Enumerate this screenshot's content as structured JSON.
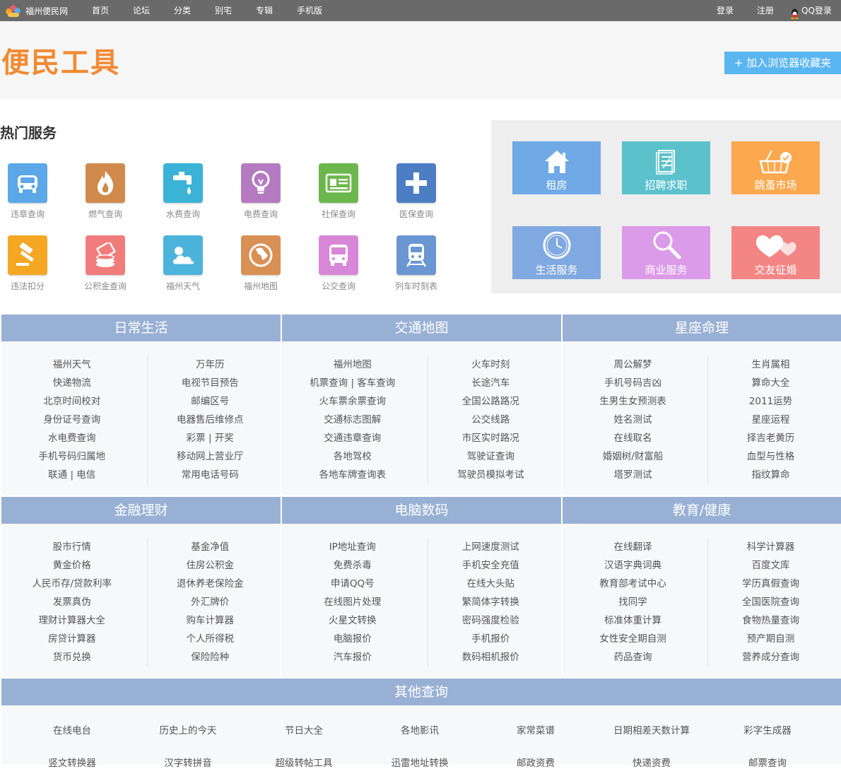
{
  "topbar": {
    "logo_text": "福州便民网",
    "nav": [
      "首页",
      "论坛",
      "分类",
      "别宅",
      "专辑",
      "手机版"
    ],
    "login": "登录",
    "register": "注册",
    "qq_login": "QQ登录"
  },
  "hero": {
    "title": "便民工具",
    "favorite_button": "+ 加入浏览器收藏夹"
  },
  "hot": {
    "title": "热门服务",
    "services": [
      {
        "label": "违章查询",
        "icon": "car-icon",
        "color": "#5ba7e8"
      },
      {
        "label": "燃气查询",
        "icon": "flame-icon",
        "color": "#d08a4c"
      },
      {
        "label": "水费查询",
        "icon": "faucet-icon",
        "color": "#3ab3d6"
      },
      {
        "label": "电费查询",
        "icon": "lightbulb-icon",
        "color": "#b57bc1"
      },
      {
        "label": "社保查询",
        "icon": "id-card-icon",
        "color": "#6cb74d"
      },
      {
        "label": "医保查询",
        "icon": "medical-cross-icon",
        "color": "#4c7ec4"
      },
      {
        "label": "违法扣分",
        "icon": "gavel-icon",
        "color": "#f5a623"
      },
      {
        "label": "公积金查询",
        "icon": "coins-icon",
        "color": "#f07c7c"
      },
      {
        "label": "福州天气",
        "icon": "weather-icon",
        "color": "#4cb3db"
      },
      {
        "label": "福州地图",
        "icon": "globe-icon",
        "color": "#d99054"
      },
      {
        "label": "公交查询",
        "icon": "bus-icon",
        "color": "#d887d8"
      },
      {
        "label": "列车时刻表",
        "icon": "train-icon",
        "color": "#6a96d1"
      }
    ],
    "tiles": [
      {
        "label": "租房",
        "icon": "house-icon",
        "color": "#6fa9e6"
      },
      {
        "label": "招聘求职",
        "icon": "document-icon",
        "color": "#5bc2cc"
      },
      {
        "label": "跳蚤市场",
        "icon": "basket-icon",
        "color": "#fba84e"
      },
      {
        "label": "生活服务",
        "icon": "clock-icon",
        "color": "#7fa9e0"
      },
      {
        "label": "商业服务",
        "icon": "magnifier-icon",
        "color": "#dc9be8"
      },
      {
        "label": "交友征婚",
        "icon": "hearts-icon",
        "color": "#f48585"
      }
    ]
  },
  "categories": [
    {
      "title": "日常生活",
      "left": [
        "福州天气",
        "快递物流",
        "北京时间校对",
        "身份证号查询",
        "水电费查询",
        "手机号码归属地",
        "联通 | 电信"
      ],
      "right": [
        "万年历",
        "电视节目预告",
        "邮编区号",
        "电器售后维修点",
        "彩票 | 开奖",
        "移动网上营业厅",
        "常用电话号码"
      ]
    },
    {
      "title": "交通地图",
      "left": [
        "福州地图",
        "机票查询 | 客车查询",
        "火车票余票查询",
        "交通标志图解",
        "交通违章查询",
        "各地驾校",
        "各地车牌查询表"
      ],
      "right": [
        "火车时刻",
        "长途汽车",
        "全国公路路况",
        "公交线路",
        "市区实时路况",
        "驾驶证查询",
        "驾驶员模拟考试"
      ]
    },
    {
      "title": "星座命理",
      "left": [
        "周公解梦",
        "手机号码吉凶",
        "生男生女预测表",
        "姓名测试",
        "在线取名",
        "婚姻树/财富船",
        "塔罗测试"
      ],
      "right": [
        "生肖属相",
        "算命大全",
        "2011运势",
        "星座运程",
        "择吉老黄历",
        "血型与性格",
        "指纹算命"
      ]
    },
    {
      "title": "金融理财",
      "left": [
        "股市行情",
        "黄金价格",
        "人民币存/贷款利率",
        "发票真伪",
        "理财计算器大全",
        "房贷计算器",
        "货币兑换"
      ],
      "right": [
        "基金净值",
        "住房公积金",
        "退休养老保险金",
        "外汇牌价",
        "购车计算器",
        "个人所得税",
        "保险险种"
      ]
    },
    {
      "title": "电脑数码",
      "left": [
        "IP地址查询",
        "免费杀毒",
        "申请QQ号",
        "在线图片处理",
        "火星文转换",
        "电脑报价",
        "汽车报价"
      ],
      "right": [
        "上网速度测试",
        "手机安全充值",
        "在线大头贴",
        "繁简体字转换",
        "密码强度检验",
        "手机报价",
        "数码相机报价"
      ]
    },
    {
      "title": "教育/健康",
      "left": [
        "在线翻译",
        "汉语字典词典",
        "教育部考试中心",
        "找同学",
        "标准体重计算",
        "女性安全期自测",
        "药品查询"
      ],
      "right": [
        "科学计算器",
        "百度文库",
        "学历真假查询",
        "全国医院查询",
        "食物热量查询",
        "预产期自测",
        "营养成分查询"
      ]
    }
  ],
  "other": {
    "title": "其他查询",
    "row1": [
      "在线电台",
      "历史上的今天",
      "节日大全",
      "各地影讯",
      "家常菜谱",
      "日期相差天数计算",
      "彩字生成器"
    ],
    "row2": [
      "竖文转换器",
      "汉字转拼音",
      "超级转帖工具",
      "迅雷地址转换",
      "邮政资费",
      "快递资费",
      "邮票查询"
    ]
  }
}
